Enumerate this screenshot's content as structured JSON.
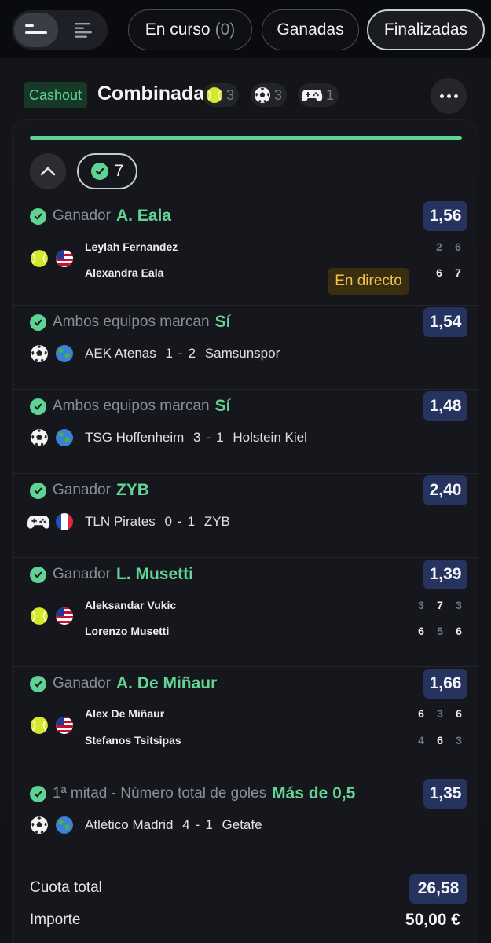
{
  "tabs": {
    "view_modes": [
      "compact-view-icon",
      "detailed-view-icon"
    ],
    "filters": [
      {
        "label": "En curso",
        "count": "(0)"
      },
      {
        "label": "Ganadas"
      },
      {
        "label": "Finalizadas",
        "active": true
      }
    ]
  },
  "bet": {
    "cashout_label": "Cashout",
    "title": "Combinada",
    "sport_counts": [
      {
        "icon": "tennis-ball-icon",
        "count": "3"
      },
      {
        "icon": "soccer-ball-icon",
        "count": "3"
      },
      {
        "icon": "gamepad-icon",
        "count": "1"
      }
    ],
    "won_count": "7",
    "progress": 1.0
  },
  "selections": [
    {
      "market": "Ganador",
      "pick": "A. Eala",
      "odds": "1,56",
      "live_label": "En directo",
      "sport_icon": "tennis-ball-icon",
      "flag_icon": "us-flag-icon",
      "players": [
        {
          "name": "Leylah Fernandez",
          "sets": [
            "2",
            "6"
          ],
          "won": [
            false,
            false
          ]
        },
        {
          "name": "Alexandra Eala",
          "sets": [
            "6",
            "7"
          ],
          "won": [
            true,
            true
          ]
        }
      ]
    },
    {
      "market": "Ambos equipos marcan",
      "pick": "Sí",
      "odds": "1,54",
      "sport_icon": "soccer-ball-icon",
      "flag_icon": "globe-icon",
      "home": "AEK Atenas",
      "home_score": "1",
      "away_score": "2",
      "away": "Samsunspor"
    },
    {
      "market": "Ambos equipos marcan",
      "pick": "Sí",
      "odds": "1,48",
      "sport_icon": "soccer-ball-icon",
      "flag_icon": "globe-icon",
      "home": "TSG Hoffenheim",
      "home_score": "3",
      "away_score": "1",
      "away": "Holstein Kiel"
    },
    {
      "market": "Ganador",
      "pick": "ZYB",
      "odds": "2,40",
      "sport_icon": "gamepad-icon",
      "flag_icon": "france-flag-icon",
      "home": "TLN Pirates",
      "home_score": "0",
      "away_score": "1",
      "away": "ZYB"
    },
    {
      "market": "Ganador",
      "pick": "L. Musetti",
      "odds": "1,39",
      "sport_icon": "tennis-ball-icon",
      "flag_icon": "us-flag-icon",
      "players": [
        {
          "name": "Aleksandar Vukic",
          "sets": [
            "3",
            "7",
            "3"
          ],
          "won": [
            false,
            true,
            false
          ]
        },
        {
          "name": "Lorenzo Musetti",
          "sets": [
            "6",
            "5",
            "6"
          ],
          "won": [
            true,
            false,
            true
          ]
        }
      ]
    },
    {
      "market": "Ganador",
      "pick": "A. De Miñaur",
      "odds": "1,66",
      "sport_icon": "tennis-ball-icon",
      "flag_icon": "us-flag-icon",
      "players": [
        {
          "name": "Alex De Miñaur",
          "sets": [
            "6",
            "3",
            "6"
          ],
          "won": [
            true,
            false,
            true
          ]
        },
        {
          "name": "Stefanos Tsitsipas",
          "sets": [
            "4",
            "6",
            "3"
          ],
          "won": [
            false,
            true,
            false
          ]
        }
      ]
    },
    {
      "market": "1ª mitad - Número total de goles",
      "pick": "Más de 0,5",
      "odds": "1,35",
      "sport_icon": "soccer-ball-icon",
      "flag_icon": "globe-icon",
      "home": "Atlético Madrid",
      "home_score": "4",
      "away_score": "1",
      "away": "Getafe"
    }
  ],
  "totals": {
    "total_odds_label": "Cuota total",
    "total_odds": "26,58",
    "stake_label": "Importe",
    "stake": "50,00 €"
  },
  "colors": {
    "accent_green": "#5fd394",
    "odds_bg": "#27335f",
    "live_yellow": "#f2c14a"
  }
}
